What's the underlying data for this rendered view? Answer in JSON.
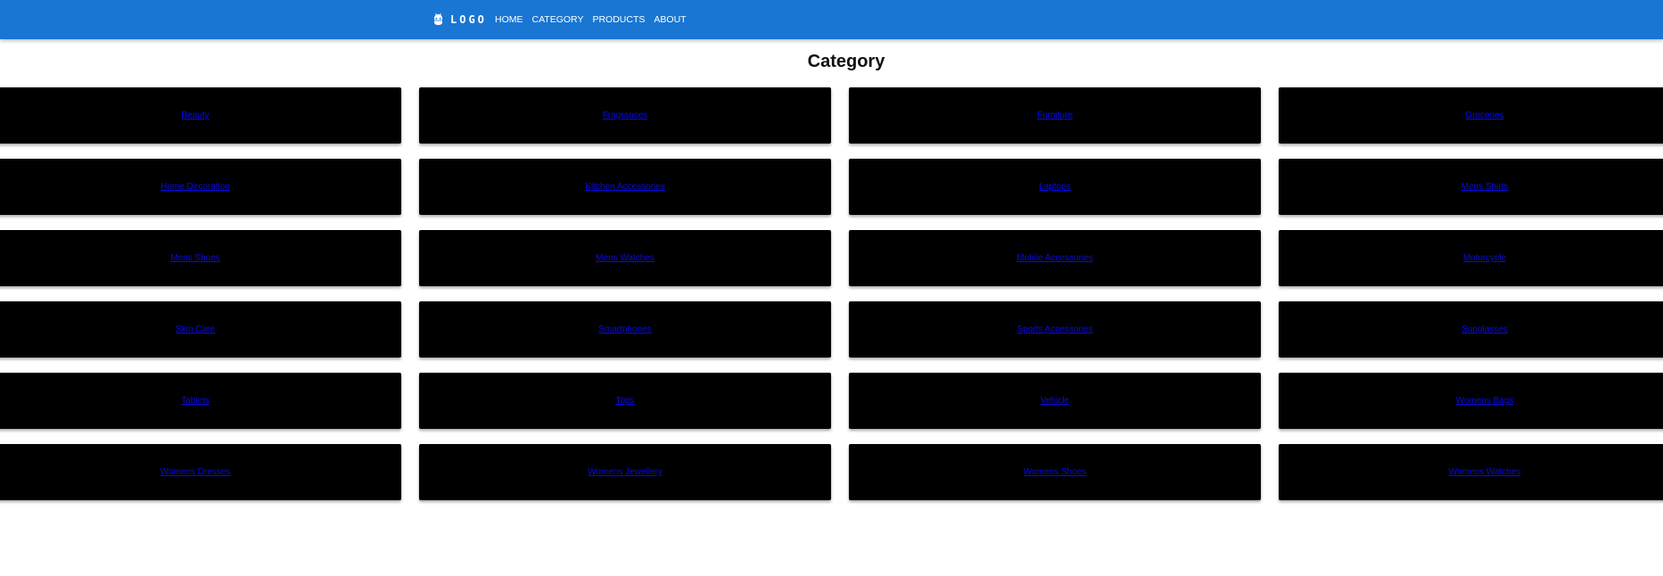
{
  "header": {
    "logo_text": "LOGO",
    "logo_icon": "adb-icon",
    "bar_color": "#1976d2",
    "nav": [
      {
        "label": "HOME"
      },
      {
        "label": "CATEGORY"
      },
      {
        "label": "PRODUCTS"
      },
      {
        "label": "ABOUT"
      }
    ]
  },
  "main": {
    "title": "Category",
    "categories": [
      {
        "label": "Beauty"
      },
      {
        "label": "Fragrances"
      },
      {
        "label": "Furniture"
      },
      {
        "label": "Groceries"
      },
      {
        "label": "Home Decoration"
      },
      {
        "label": "Kitchen Accessories"
      },
      {
        "label": "Laptops"
      },
      {
        "label": "Mens Shirts"
      },
      {
        "label": "Mens Shoes"
      },
      {
        "label": "Mens Watches"
      },
      {
        "label": "Mobile Accessories"
      },
      {
        "label": "Motorcycle"
      },
      {
        "label": "Skin Care"
      },
      {
        "label": "Smartphones"
      },
      {
        "label": "Sports Accessories"
      },
      {
        "label": "Sunglasses"
      },
      {
        "label": "Tablets"
      },
      {
        "label": "Tops"
      },
      {
        "label": "Vehicle"
      },
      {
        "label": "Womens Bags"
      },
      {
        "label": "Womens Dresses"
      },
      {
        "label": "Womens Jewellery"
      },
      {
        "label": "Womens Shoes"
      },
      {
        "label": "Womens Watches"
      }
    ],
    "card_color": "#000000",
    "link_color": "#0a0ae6"
  }
}
